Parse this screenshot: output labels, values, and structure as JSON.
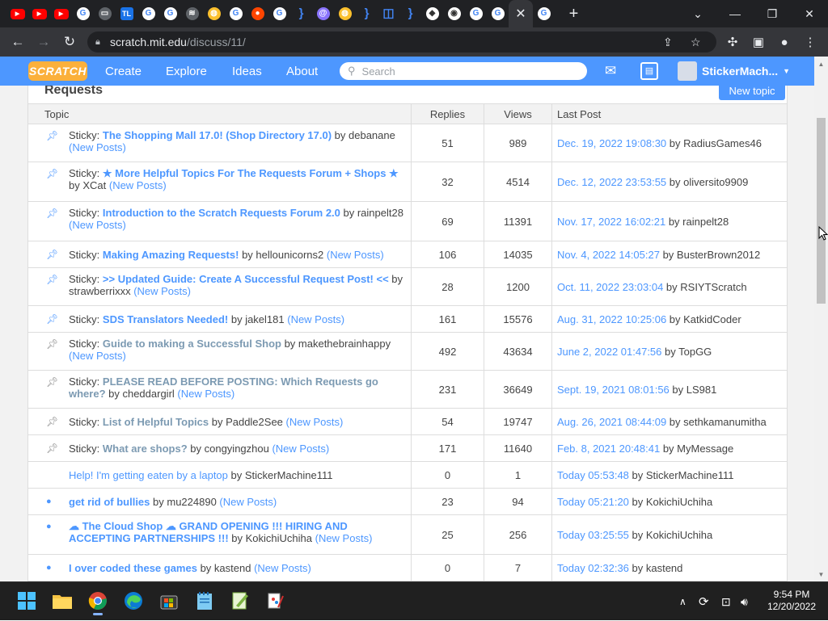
{
  "browser": {
    "url_host": "scratch.mit.edu",
    "url_path": "/discuss/11/",
    "tab_icons": [
      "youtube-icon",
      "youtube-icon",
      "youtube-icon",
      "google-icon",
      "monitor-icon",
      "tl-icon",
      "google-icon",
      "google-icon",
      "wifi-icon",
      "bread-icon",
      "google-icon",
      "reddit-icon",
      "google-icon",
      "brackets-icon",
      "at-icon",
      "bread-icon",
      "brackets-icon",
      "chat-icon",
      "brackets-icon",
      "dice-icon",
      "chrome-icon",
      "google-icon",
      "google-icon",
      "google-icon"
    ],
    "tl_label": "TL",
    "new_tab": "+"
  },
  "navbar": {
    "logo": "SCRATCH",
    "links": [
      "Create",
      "Explore",
      "Ideas",
      "About"
    ],
    "search_placeholder": "Search",
    "username": "StickerMach..."
  },
  "forum": {
    "title": "Requests",
    "new_topic": "New topic",
    "headers": {
      "topic": "Topic",
      "replies": "Replies",
      "views": "Views",
      "last_post": "Last Post"
    },
    "sticky_prefix": "Sticky:",
    "by_word": "by",
    "new_posts": "(New Posts)",
    "rows": [
      {
        "marker": "pin-blue",
        "sticky": true,
        "title": "The Shopping Mall 17.0! (Shop Directory 17.0)",
        "read": false,
        "author": "debanane",
        "new_posts": true,
        "replies": "51",
        "views": "989",
        "last_date": "Dec. 19, 2022 19:08:30",
        "last_user": "RadiusGames46"
      },
      {
        "marker": "pin-blue",
        "sticky": true,
        "title": "★ More Helpful Topics For The Requests Forum + Shops ★",
        "read": false,
        "author": "XCat",
        "new_posts": true,
        "replies": "32",
        "views": "4514",
        "last_date": "Dec. 12, 2022 23:53:55",
        "last_user": "oliversito9909"
      },
      {
        "marker": "pin-blue",
        "sticky": true,
        "title": "Introduction to the Scratch Requests Forum 2.0",
        "read": false,
        "author": "rainpelt28",
        "new_posts": true,
        "replies": "69",
        "views": "11391",
        "last_date": "Nov. 17, 2022 16:02:21",
        "last_user": "rainpelt28"
      },
      {
        "marker": "pin-blue",
        "sticky": true,
        "title": "Making Amazing Requests!",
        "read": false,
        "author": "hellounicorns2",
        "new_posts": true,
        "replies": "106",
        "views": "14035",
        "last_date": "Nov. 4, 2022 14:05:27",
        "last_user": "BusterBrown2012"
      },
      {
        "marker": "pin-blue",
        "sticky": true,
        "title": ">> Updated Guide: Create A Successful Request Post! <<",
        "read": false,
        "author": "strawberrixxx",
        "new_posts": true,
        "replies": "28",
        "views": "1200",
        "last_date": "Oct. 11, 2022 23:03:04",
        "last_user": "RSIYTScratch"
      },
      {
        "marker": "pin-blue",
        "sticky": true,
        "title": "SDS Translators Needed!",
        "read": false,
        "author": "jakel181",
        "new_posts": true,
        "replies": "161",
        "views": "15576",
        "last_date": "Aug. 31, 2022 10:25:06",
        "last_user": "KatkidCoder"
      },
      {
        "marker": "pin-gray",
        "sticky": true,
        "title": "Guide to making a Successful Shop",
        "read": true,
        "author": "makethebrainhappy",
        "new_posts": true,
        "replies": "492",
        "views": "43634",
        "last_date": "June 2, 2022 01:47:56",
        "last_user": "TopGG"
      },
      {
        "marker": "pin-gray",
        "sticky": true,
        "title": "PLEASE READ BEFORE POSTING: Which Requests go where?",
        "read": true,
        "author": "cheddargirl",
        "new_posts": true,
        "replies": "231",
        "views": "36649",
        "last_date": "Sept. 19, 2021 08:01:56",
        "last_user": "LS981"
      },
      {
        "marker": "pin-gray",
        "sticky": true,
        "title": "List of Helpful Topics",
        "read": true,
        "author": "Paddle2See",
        "new_posts": true,
        "replies": "54",
        "views": "19747",
        "last_date": "Aug. 26, 2021 08:44:09",
        "last_user": "sethkamanumitha"
      },
      {
        "marker": "pin-gray",
        "sticky": true,
        "title": "What are shops?",
        "read": true,
        "author": "congyingzhou",
        "new_posts": true,
        "replies": "171",
        "views": "11640",
        "last_date": "Feb. 8, 2021 20:48:41",
        "last_user": "MyMessage"
      },
      {
        "marker": "none",
        "sticky": false,
        "title": "Help! I'm getting eaten by a laptop",
        "read": false,
        "plain": true,
        "author": "StickerMachine111",
        "new_posts": false,
        "replies": "0",
        "views": "1",
        "last_date": "Today 05:53:48",
        "last_user": "StickerMachine111"
      },
      {
        "marker": "dot",
        "sticky": false,
        "title": "get rid of bullies",
        "read": false,
        "author": "mu224890",
        "new_posts": true,
        "replies": "23",
        "views": "94",
        "last_date": "Today 05:21:20",
        "last_user": "KokichiUchiha"
      },
      {
        "marker": "dot",
        "sticky": false,
        "title": "☁ The Cloud Shop ☁ GRAND OPENING !!! HIRING AND ACCEPTING PARTNERSHIPS !!!",
        "read": false,
        "author": "KokichiUchiha",
        "new_posts": true,
        "replies": "25",
        "views": "256",
        "last_date": "Today 03:25:55",
        "last_user": "KokichiUchiha"
      },
      {
        "marker": "dot",
        "sticky": false,
        "title": "I over coded these games",
        "read": false,
        "author": "kastend",
        "new_posts": true,
        "replies": "0",
        "views": "7",
        "last_date": "Today 02:32:36",
        "last_user": "kastend"
      }
    ]
  },
  "taskbar": {
    "apps": [
      "windows-start-icon",
      "file-explorer-icon",
      "chrome-icon",
      "edge-icon",
      "store-icon",
      "notepad-icon",
      "notepad-plus-icon",
      "paint-icon"
    ],
    "time": "9:54 PM",
    "date": "12/20/2022"
  },
  "colors": {
    "scratch_blue": "#4d97ff",
    "scratch_orange": "#fbb03b",
    "read_link": "#7c9ab2"
  }
}
